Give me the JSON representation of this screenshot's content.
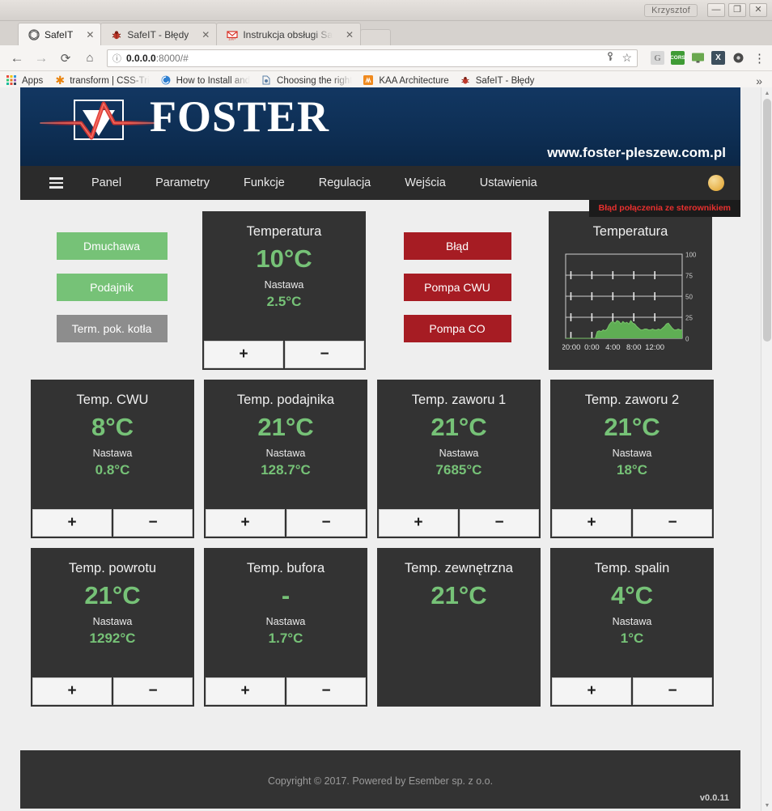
{
  "browser": {
    "window_user": "Krzysztof",
    "window_buttons": {
      "minimize": "—",
      "maximize": "❐",
      "close": "✕"
    },
    "tabs": [
      {
        "title": "SafeIT",
        "icon": "safeit-icon",
        "close": "✕",
        "active": true
      },
      {
        "title": "SafeIT - Błędy",
        "icon": "bug-icon",
        "close": "✕",
        "active": false
      },
      {
        "title": "Instrukcja obsługi Sa",
        "icon": "gmail-icon",
        "close": "✕",
        "active": false
      }
    ],
    "toolbar": {
      "back": "←",
      "forward": "→",
      "reload": "⟳",
      "home": "⌂",
      "url_host": "0.0.0.0",
      "url_rest": ":8000/#",
      "info_icon": "ⓘ",
      "save_password_icon": "key-icon",
      "bookmark_star": "☆",
      "menu": "⋮",
      "extensions": [
        {
          "name": "google-extension",
          "label": "G",
          "color": "#b7b7b7"
        },
        {
          "name": "cors-extension",
          "label": "CORS",
          "color": "#3f9b35"
        },
        {
          "name": "monitor-extension",
          "label": "",
          "color": "#6aa84f"
        },
        {
          "name": "x-extension",
          "label": "X",
          "color": "#3d4f5d"
        },
        {
          "name": "dark-extension",
          "label": "",
          "color": "#4a4a4a"
        }
      ]
    },
    "bookmarks": {
      "apps_label": "Apps",
      "items": [
        {
          "label": "transform | CSS-Tri",
          "icon": "asterisk-icon",
          "color": "#e8820c",
          "truncated": true
        },
        {
          "label": "How to Install and",
          "icon": "circle-icon",
          "color": "#2f7fd0",
          "truncated": true
        },
        {
          "label": "Choosing the right",
          "icon": "doc-icon",
          "color": "#5b7fa6",
          "truncated": true
        },
        {
          "label": "KAA Architecture",
          "icon": "kaa-icon",
          "color": "#f08a1e",
          "truncated": false
        },
        {
          "label": "SafeIT - Błędy",
          "icon": "bug-icon",
          "color": "#c0392b",
          "truncated": false
        }
      ],
      "overflow": "»"
    }
  },
  "site": {
    "brand": "FOSTER",
    "url": "www.foster-pleszew.com.pl",
    "nav": [
      {
        "label": "Panel"
      },
      {
        "label": "Parametry"
      },
      {
        "label": "Funkcje"
      },
      {
        "label": "Regulacja"
      },
      {
        "label": "Wejścia"
      },
      {
        "label": "Ustawienia"
      }
    ],
    "menu_icon": "hamburger-icon",
    "status_indicator": "status-dot",
    "error_toast": "Błąd połączenia ze sterownikiem",
    "colors": {
      "banner": "#0e2f55",
      "navbar": "#2b2b2b",
      "accent_green": "#76c277",
      "accent_red": "#a61c23",
      "tile_bg": "#333333"
    }
  },
  "controls": {
    "left_buttons": [
      {
        "label": "Dmuchawa",
        "state": "on"
      },
      {
        "label": "Podajnik",
        "state": "on"
      },
      {
        "label": "Term. pok. kotła",
        "state": "off"
      }
    ],
    "mid_buttons": [
      {
        "label": "Błąd",
        "state": "alarm"
      },
      {
        "label": "Pompa CWU",
        "state": "alarm"
      },
      {
        "label": "Pompa CO",
        "state": "alarm"
      }
    ],
    "plus_label": "+",
    "minus_label": "−",
    "setpoint_label": "Nastawa"
  },
  "tiles": [
    {
      "title": "Temperatura",
      "value": "10°C",
      "setpoint_label": "Nastawa",
      "setpoint": "2.5°C",
      "has_buttons": true
    },
    {
      "title": "Temp. CWU",
      "value": "8°C",
      "setpoint_label": "Nastawa",
      "setpoint": "0.8°C",
      "has_buttons": true
    },
    {
      "title": "Temp. podajnika",
      "value": "21°C",
      "setpoint_label": "Nastawa",
      "setpoint": "128.7°C",
      "has_buttons": true
    },
    {
      "title": "Temp. zaworu 1",
      "value": "21°C",
      "setpoint_label": "Nastawa",
      "setpoint": "7685°C",
      "has_buttons": true
    },
    {
      "title": "Temp. zaworu 2",
      "value": "21°C",
      "setpoint_label": "Nastawa",
      "setpoint": "18°C",
      "has_buttons": true
    },
    {
      "title": "Temp. powrotu",
      "value": "21°C",
      "setpoint_label": "Nastawa",
      "setpoint": "1292°C",
      "has_buttons": true
    },
    {
      "title": "Temp. bufora",
      "value": "-",
      "setpoint_label": "Nastawa",
      "setpoint": "1.7°C",
      "has_buttons": true
    },
    {
      "title": "Temp. zewnętrzna",
      "value": "21°C",
      "setpoint_label": "",
      "setpoint": "",
      "has_buttons": false
    },
    {
      "title": "Temp. spalin",
      "value": "4°C",
      "setpoint_label": "Nastawa",
      "setpoint": "1°C",
      "has_buttons": true
    }
  ],
  "chart_data": {
    "type": "area",
    "title": "Temperatura",
    "xlabel": "",
    "ylabel": "",
    "ylim": [
      0,
      100
    ],
    "yticks": [
      0,
      25,
      50,
      75,
      100
    ],
    "ytick_labels": [
      "0",
      "25",
      "50",
      "75",
      "100"
    ],
    "xtick_labels": [
      "20:00",
      "0:00",
      "4:00",
      "8:00",
      "12:00"
    ],
    "grid": true,
    "legend": "none",
    "series_color": "#5fae54",
    "x": [
      "19:00",
      "19:20",
      "19:40",
      "20:00",
      "20:20",
      "20:40",
      "21:00",
      "21:20",
      "21:40",
      "22:00",
      "22:20",
      "22:40",
      "23:00",
      "23:20",
      "23:40",
      "0:00",
      "0:20",
      "0:40",
      "1:00",
      "1:20",
      "1:40",
      "2:00",
      "2:20",
      "2:40",
      "3:00",
      "3:20",
      "3:40",
      "4:00",
      "4:20",
      "4:40",
      "5:00",
      "5:20",
      "5:40",
      "6:00",
      "6:20",
      "6:40",
      "7:00",
      "7:20",
      "7:40",
      "8:00",
      "8:20",
      "8:40",
      "9:00",
      "9:20",
      "9:40",
      "10:00",
      "10:20",
      "10:40",
      "11:00",
      "11:20",
      "11:40",
      "12:00",
      "12:20",
      "12:40",
      "13:00",
      "13:20",
      "13:40",
      "14:00",
      "14:20",
      "14:40"
    ],
    "values": [
      0,
      0,
      0,
      0,
      0,
      0,
      0,
      0,
      0,
      0,
      0,
      0,
      0,
      0,
      0,
      0,
      8,
      9,
      8,
      10,
      9,
      11,
      16,
      19,
      20,
      18,
      21,
      20,
      17,
      20,
      18,
      19,
      17,
      21,
      18,
      17,
      14,
      12,
      10,
      10,
      11,
      11,
      10,
      10,
      11,
      10,
      10,
      11,
      10,
      12,
      14,
      17,
      18,
      15,
      12,
      10,
      10,
      11,
      10,
      10
    ]
  },
  "footer": {
    "copyright": "Copyright © 2017. Powered by Esember sp. z o.o.",
    "version": "v0.0.11"
  }
}
